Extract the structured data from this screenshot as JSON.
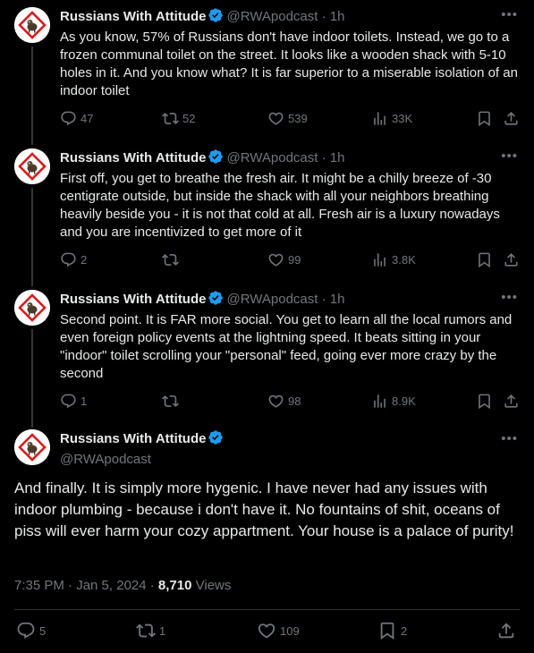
{
  "author": {
    "name": "Russians With Attitude",
    "handle": "@RWApodcast"
  },
  "colors": {
    "background": "#000000",
    "text": "#e7e9ea",
    "muted": "#71767b",
    "verified": "#1d9bf0",
    "avatar_border": "#d81b1b"
  },
  "icons": [
    "more-icon",
    "reply-icon",
    "retweet-icon",
    "like-icon",
    "views-icon",
    "bookmark-icon",
    "share-icon",
    "verified-badge-icon"
  ],
  "tweets": [
    {
      "separator": "·",
      "time": "1h",
      "text": "As you know, 57% of Russians don't have indoor toilets. Instead, we go to a frozen communal toilet on the street. It looks like a wooden shack with 5-10 holes in it. And you know what? It is far superior to a miserable isolation of an indoor toilet",
      "replies": "47",
      "reposts": "52",
      "likes": "539",
      "views": "33K"
    },
    {
      "separator": "·",
      "time": "1h",
      "text": "First off, you get to breathe the fresh air. It might be a chilly breeze of -30 centigrate outside, but inside the shack with all your neighbors breathing heavily beside you - it is not that cold at all. Fresh air is a luxury nowadays and you are incentivized to get more of it",
      "replies": "2",
      "reposts": "",
      "likes": "99",
      "views": "3.8K"
    },
    {
      "separator": "·",
      "time": "1h",
      "text": "Second point. It is FAR more social. You get to learn all the local rumors and even foreign policy events at the lightning speed. It beats sitting in your \"indoor\" toilet scrolling your \"personal\" feed, going ever more crazy by the second",
      "replies": "1",
      "reposts": "",
      "likes": "98",
      "views": "8.9K"
    }
  ],
  "main_tweet": {
    "text": "And finally. It is simply more hygenic. I have never had any issues with indoor plumbing - because i don't have it. No fountains of shit, oceans of piss will ever harm your cozy appartment. Your house is a palace of purity!",
    "timestamp": "7:35 PM · Jan 5, 2024 · ",
    "views_count": "8,710",
    "views_label": " Views",
    "replies": "5",
    "reposts": "1",
    "likes": "109",
    "bookmarks": "2"
  }
}
